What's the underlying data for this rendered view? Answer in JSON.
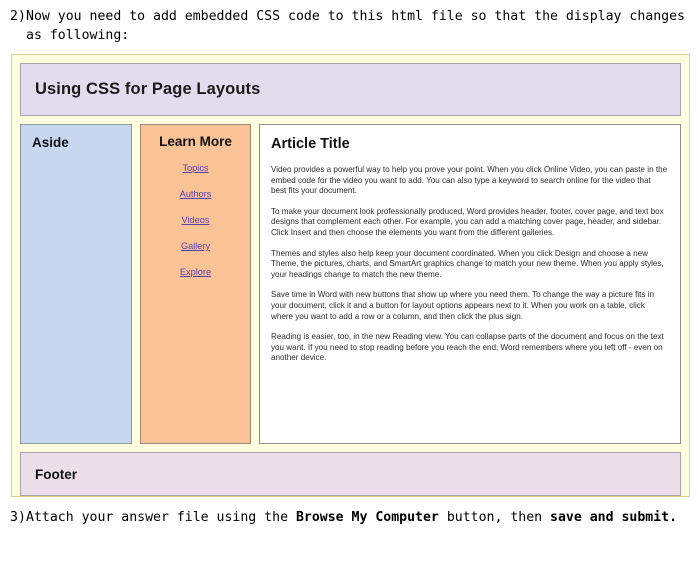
{
  "instructions": {
    "step2": {
      "number": "2)",
      "text": "Now you need to add embedded CSS code to this html file so that the display changes as following:"
    },
    "step3": {
      "number": "3)",
      "prefix": "Attach your answer file using the ",
      "bold1": "Browse My Computer",
      "middle": " button, then ",
      "bold2": "save and submit."
    }
  },
  "layout": {
    "header": {
      "title": "Using CSS for Page Layouts",
      "bg": "#e2ddee"
    },
    "aside": {
      "label": "Aside",
      "bg": "#c6d7ef"
    },
    "nav": {
      "label": "Learn More",
      "bg": "#f9c396",
      "link_color": "#5d3fb0",
      "links": [
        {
          "label": "Topics"
        },
        {
          "label": "Authors"
        },
        {
          "label": "Videos"
        },
        {
          "label": "Gallery"
        },
        {
          "label": "Explore"
        }
      ]
    },
    "article": {
      "title": "Article Title",
      "paragraphs": [
        "Video provides a powerful way to help you prove your point. When you click Online Video, you can paste in the embed code for the video you want to add. You can also type a keyword to search online for the video that best fits your document.",
        "To make your document look professionally produced, Word provides header, footer, cover page, and text box designs that complement each other. For example, you can add a matching cover page, header, and sidebar. Click Insert and then choose the elements you want from the different galleries.",
        "Themes and styles also help keep your document coordinated. When you click Design and choose a new Theme, the pictures, charts, and SmartArt graphics change to match your new theme. When you apply styles, your headings change to match the new theme.",
        "Save time in Word with new buttons that show up where you need them. To change the way a picture fits in your document, click it and a button for layout options appears next to it. When you work on a table, click where you want to add a row or a column, and then click the plus sign.",
        "Reading is easier, too, in the new Reading view. You can collapse parts of the document and focus on the text you want. If you need to stop reading before you reach the end, Word remembers where you left off - even on another device."
      ]
    },
    "footer": {
      "label": "Footer",
      "bg": "#ecdfe9"
    },
    "container_bg": "#ffffdf"
  }
}
